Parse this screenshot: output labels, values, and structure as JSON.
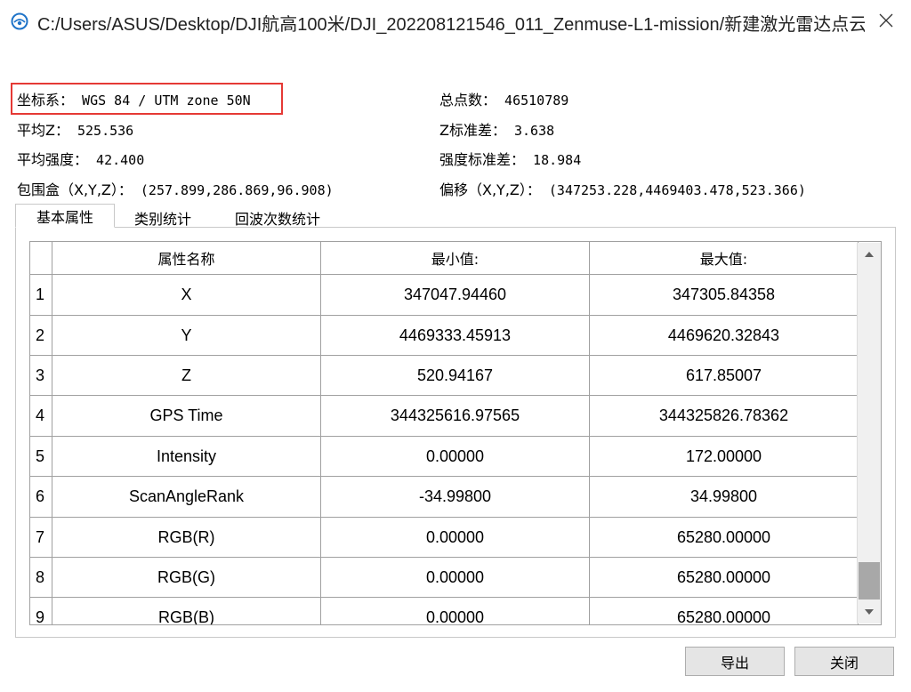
{
  "window": {
    "title": "C:/Users/ASUS/Desktop/DJI航高100米/DJI_202208121546_011_Zenmuse-L1-mission/新建激光雷达点云..."
  },
  "info": {
    "crs_label": "坐标系：",
    "crs_value": "WGS 84 / UTM zone 50N",
    "total_points_label": "总点数：",
    "total_points_value": "46510789",
    "mean_z_label": "平均Z：",
    "mean_z_value": "525.536",
    "z_std_label": "Z标准差：",
    "z_std_value": "3.638",
    "mean_intensity_label": "平均强度：",
    "mean_intensity_value": "42.400",
    "intensity_std_label": "强度标准差：",
    "intensity_std_value": "18.984",
    "bbox_label": "包围盒（X,Y,Z）：",
    "bbox_value": "(257.899,286.869,96.908)",
    "offset_label": "偏移（X,Y,Z）：",
    "offset_value": "(347253.228,4469403.478,523.366)"
  },
  "tabs": [
    "基本属性",
    "类别统计",
    "回波次数统计"
  ],
  "table": {
    "headers": [
      "属性名称",
      "最小值:",
      "最大值:"
    ],
    "rows": [
      {
        "index": "1",
        "name": "X",
        "min": "347047.94460",
        "max": "347305.84358"
      },
      {
        "index": "2",
        "name": "Y",
        "min": "4469333.45913",
        "max": "4469620.32843"
      },
      {
        "index": "3",
        "name": "Z",
        "min": "520.94167",
        "max": "617.85007"
      },
      {
        "index": "4",
        "name": "GPS Time",
        "min": "344325616.97565",
        "max": "344325826.78362"
      },
      {
        "index": "5",
        "name": "Intensity",
        "min": "0.00000",
        "max": "172.00000"
      },
      {
        "index": "6",
        "name": "ScanAngleRank",
        "min": "-34.99800",
        "max": "34.99800"
      },
      {
        "index": "7",
        "name": "RGB(R)",
        "min": "0.00000",
        "max": "65280.00000"
      },
      {
        "index": "8",
        "name": "RGB(G)",
        "min": "0.00000",
        "max": "65280.00000"
      },
      {
        "index": "9",
        "name": "RGB(B)",
        "min": "0.00000",
        "max": "65280.00000"
      }
    ]
  },
  "buttons": {
    "export": "导出",
    "close": "关闭"
  },
  "colors": {
    "highlight": "#e53935",
    "grid_line": "#a0a0a0",
    "button_bg": "#e5e5e5"
  }
}
